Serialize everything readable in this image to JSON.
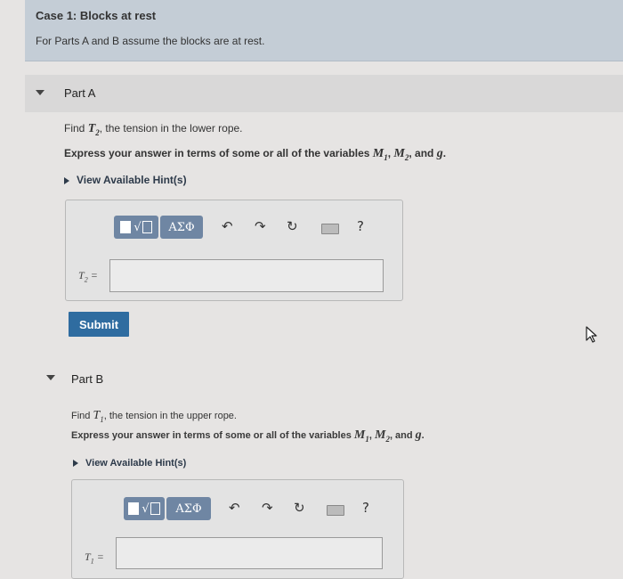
{
  "case": {
    "title": "Case 1: Blocks at rest",
    "subtitle": "For Parts A and B assume the blocks are at rest."
  },
  "part_a": {
    "title": "Part A",
    "find_prefix": "Find ",
    "find_var": "T",
    "find_sub": "2",
    "find_suffix": ", the tension in the lower rope.",
    "express_prefix": "Express your answer in terms of some or all of the variables ",
    "var1": "M",
    "var1_sub": "1",
    "sep1": ", ",
    "var2": "M",
    "var2_sub": "2",
    "sep2": ", and ",
    "var3": "g",
    "express_end": ".",
    "hint": "View Available Hint(s)",
    "answer_var": "T",
    "answer_sub": "2",
    "answer_eq": " =",
    "answer_value": "",
    "submit": "Submit"
  },
  "part_b": {
    "title": "Part B",
    "find_prefix": "Find ",
    "find_var": "T",
    "find_sub": "1",
    "find_suffix": ", the tension in the upper rope.",
    "express_prefix": "Express your answer in terms of some or all of the variables ",
    "var1": "M",
    "var1_sub": "1",
    "sep1": ", ",
    "var2": "M",
    "var2_sub": "2",
    "sep2": ", and ",
    "var3": "g",
    "express_end": ".",
    "hint": "View Available Hint(s)",
    "answer_var": "T",
    "answer_sub": "1",
    "answer_eq": " =",
    "answer_value": ""
  },
  "toolbar": {
    "template_radical": "√",
    "greek_label": "ΑΣΦ",
    "undo_glyph": "↶",
    "redo_glyph": "↷",
    "reset_glyph": "↻",
    "help_glyph": "?",
    "icons": [
      "templates-icon",
      "greek-letters-icon",
      "undo-icon",
      "redo-icon",
      "reset-icon",
      "keyboard-icon",
      "help-icon"
    ]
  },
  "colors": {
    "case_header_bg": "#c4cdd6",
    "toolbar_button": "#6f86a3",
    "submit_button": "#2f6ca0"
  }
}
